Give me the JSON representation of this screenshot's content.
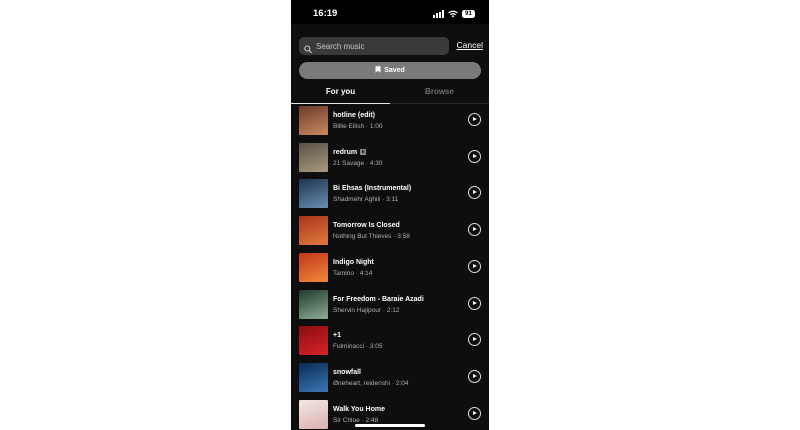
{
  "status_bar": {
    "time": "16:19",
    "battery": "91"
  },
  "search": {
    "placeholder": "Search music",
    "value": ""
  },
  "cancel_label": "Cancel",
  "saved_label": "Saved",
  "tabs": [
    {
      "label": "For you",
      "active": true
    },
    {
      "label": "Browse",
      "active": false
    }
  ],
  "tracks": [
    {
      "title": "hotline (edit)",
      "meta": "Billie Eilish · 1:00",
      "explicit": false,
      "art_colors": [
        "#6b3a2a",
        "#c98a62"
      ]
    },
    {
      "title": "redrum",
      "meta": "21 Savage · 4:30",
      "explicit": true,
      "art_colors": [
        "#5a5246",
        "#a89a80"
      ]
    },
    {
      "title": "Bi Ehsas (Instrumental)",
      "meta": "Shadmehr Aghili · 3:11",
      "explicit": false,
      "art_colors": [
        "#1c3550",
        "#6b8fb0"
      ]
    },
    {
      "title": "Tomorrow Is Closed",
      "meta": "Nothing But Thieves · 3:58",
      "explicit": false,
      "art_colors": [
        "#a8361e",
        "#e07a3c"
      ]
    },
    {
      "title": "Indigo Night",
      "meta": "Tamino · 4:14",
      "explicit": false,
      "art_colors": [
        "#c2361c",
        "#f08a3a"
      ]
    },
    {
      "title": "For Freedom - Baraie Azadi",
      "meta": "Shervin Hajipour · 2:12",
      "explicit": false,
      "art_colors": [
        "#1f3a2a",
        "#8fae98"
      ]
    },
    {
      "title": "+1",
      "meta": "Fulminacci · 3:05",
      "explicit": false,
      "art_colors": [
        "#8a0d10",
        "#d8232a"
      ]
    },
    {
      "title": "snowfall",
      "meta": "Øneheart, reidenshi · 2:04",
      "explicit": false,
      "art_colors": [
        "#0b2a52",
        "#3a78b8"
      ]
    },
    {
      "title": "Walk You Home",
      "meta": "Sir Chloe · 2:48",
      "explicit": false,
      "art_colors": [
        "#f2e8e4",
        "#d9b0b0"
      ]
    }
  ],
  "colors": {
    "background": "#000000",
    "sheet": "#0e0e0e",
    "search_field": "#3a3a3c",
    "saved_pill": "#7a7a7a"
  },
  "icons": {
    "search": "search-icon",
    "saved": "bookmark-icon",
    "play": "play-icon"
  }
}
